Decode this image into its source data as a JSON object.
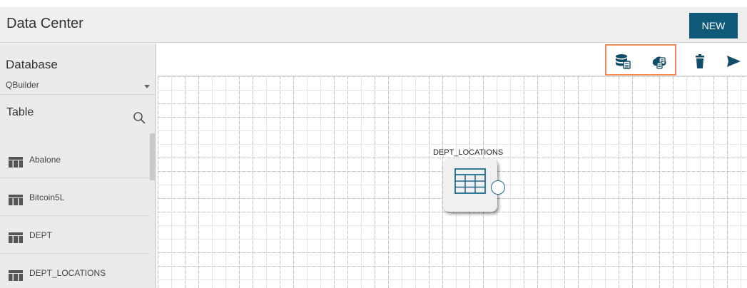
{
  "header": {
    "title": "Data Center",
    "new_button": "NEW"
  },
  "sidebar": {
    "database_label": "Database",
    "database_value": "QBuilder",
    "table_label": "Table",
    "tables": [
      "Abalone",
      "Bitcoin5L",
      "DEPT",
      "DEPT_LOCATIONS"
    ]
  },
  "toolbar": {
    "icons": [
      "database-icon",
      "cloud-data-icon",
      "trash-icon",
      "send-icon"
    ],
    "highlight_color": "#ef8a5b"
  },
  "canvas": {
    "node_label": "DEPT_LOCATIONS",
    "node_icon": "table-grid-icon"
  },
  "colors": {
    "accent": "#0e5a78",
    "icon": "#0f4d68"
  }
}
